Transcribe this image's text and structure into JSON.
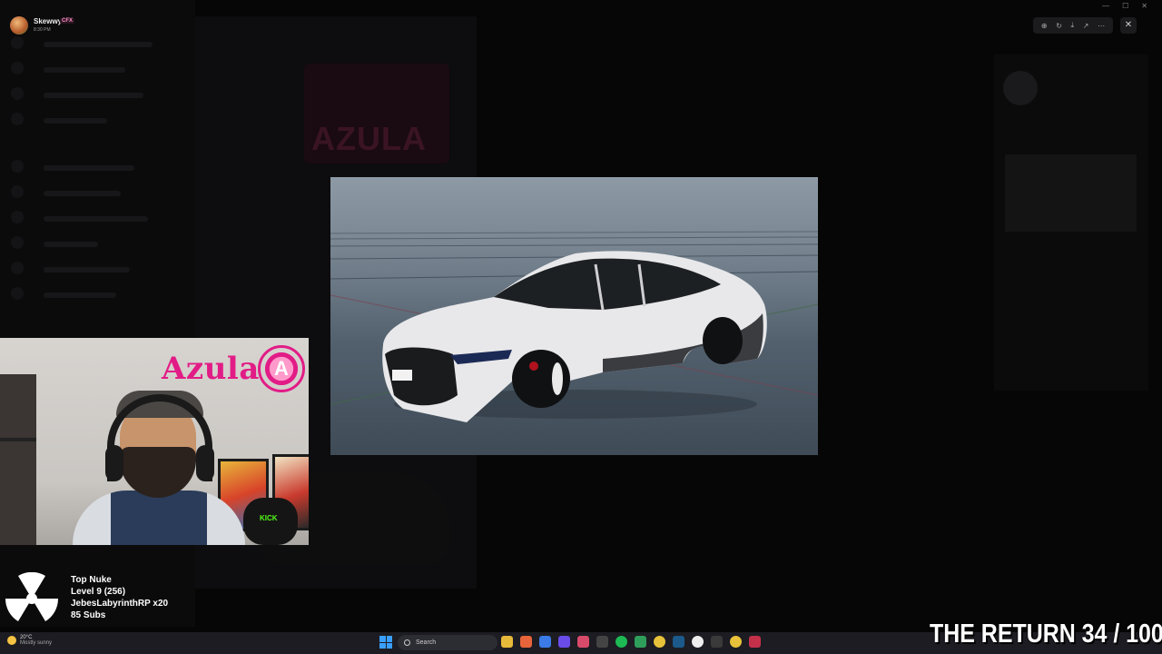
{
  "topbar": {
    "user_name": "Skewwy",
    "user_heart": "♥",
    "user_tag": "CFX",
    "timestamp": "8:30 PM",
    "tools": [
      "zoom-in-icon",
      "rotate-icon",
      "download-icon",
      "open-external-icon",
      "more-icon"
    ],
    "close_symbol": "✕",
    "window_controls": [
      "—",
      "☐",
      "✕"
    ]
  },
  "background": {
    "banner_text": "AZULA"
  },
  "webcam": {
    "brand_text": "Azula",
    "logo_letter": "A",
    "mic_label": "KICK"
  },
  "top_nuke": {
    "title": "Top Nuke",
    "level": "Level 9  (256)",
    "user": "JebesLabyrinthRP x20",
    "subs": "85 Subs"
  },
  "taskbar": {
    "temperature": "20°C",
    "weather_desc": "Mostly sunny",
    "search_text": "Search"
  },
  "overlay": {
    "counter_text": "THE RETURN  34 / 100"
  },
  "colors": {
    "brand_pink": "#e21c86",
    "kick_green": "#53fc18",
    "taskbar": "#1c1c22"
  }
}
